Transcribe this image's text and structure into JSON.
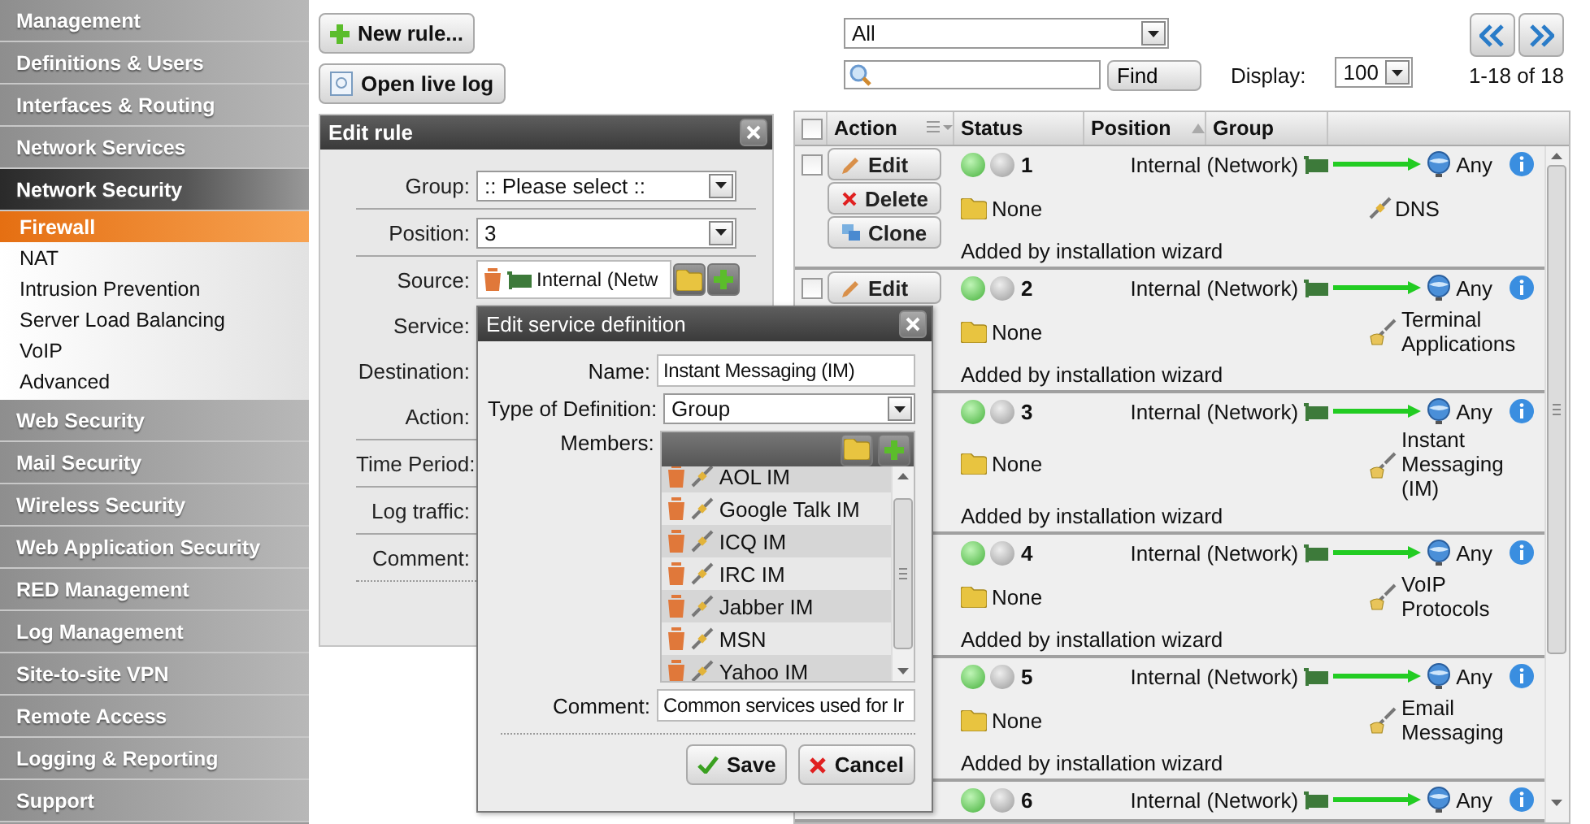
{
  "sidebar": {
    "items": [
      {
        "label": "Management",
        "expanded": false
      },
      {
        "label": "Definitions & Users",
        "expanded": false
      },
      {
        "label": "Interfaces & Routing",
        "expanded": false
      },
      {
        "label": "Network Services",
        "expanded": false
      },
      {
        "label": "Network Security",
        "expanded": true,
        "children": [
          {
            "label": "Firewall",
            "selected": true
          },
          {
            "label": "NAT",
            "selected": false
          },
          {
            "label": "Intrusion Prevention",
            "selected": false
          },
          {
            "label": "Server Load Balancing",
            "selected": false
          },
          {
            "label": "VoIP",
            "selected": false
          },
          {
            "label": "Advanced",
            "selected": false
          }
        ]
      },
      {
        "label": "Web Security",
        "expanded": false
      },
      {
        "label": "Mail Security",
        "expanded": false
      },
      {
        "label": "Wireless Security",
        "expanded": false
      },
      {
        "label": "Web Application Security",
        "expanded": false
      },
      {
        "label": "RED Management",
        "expanded": false
      },
      {
        "label": "Log Management",
        "expanded": false
      },
      {
        "label": "Site-to-site VPN",
        "expanded": false
      },
      {
        "label": "Remote Access",
        "expanded": false
      },
      {
        "label": "Logging & Reporting",
        "expanded": false
      },
      {
        "label": "Support",
        "expanded": false
      }
    ]
  },
  "toolbar": {
    "buttons": [
      {
        "label": "New rule...",
        "kind": "add"
      },
      {
        "label": "Open live log",
        "kind": "log"
      }
    ]
  },
  "filter": {
    "value": "All"
  },
  "search": {
    "button": "Find"
  },
  "display": {
    "label": "Display:",
    "value": "100"
  },
  "pager": {
    "range": "1-18 of 18"
  },
  "edit_rule": {
    "title": "Edit rule",
    "sections": [
      [
        {
          "label": "Group:",
          "kind": "select",
          "value": ":: Please select ::"
        }
      ],
      [
        {
          "label": "Position:",
          "kind": "select",
          "value": "3"
        }
      ],
      [
        {
          "label": "Source:",
          "kind": "object",
          "value": "Internal (Netw"
        },
        {
          "label": "Service:",
          "kind": "covered"
        },
        {
          "label": "Destination:",
          "kind": "covered"
        },
        {
          "label": "Action:",
          "kind": "covered"
        }
      ],
      [
        {
          "label": "Time Period:",
          "kind": "covered"
        }
      ],
      [
        {
          "label": "Log traffic:",
          "kind": "covered"
        }
      ],
      [
        {
          "label": "Comment:",
          "kind": "covered"
        }
      ]
    ]
  },
  "service_dialog": {
    "title": "Edit service definition",
    "name_label": "Name:",
    "name": "Instant Messaging (IM)",
    "type_label": "Type of Definition:",
    "type": "Group",
    "members_label": "Members:",
    "members": [
      "AOL IM",
      "Google Talk IM",
      "ICQ IM",
      "IRC IM",
      "Jabber IM",
      "MSN",
      "Yahoo IM"
    ],
    "comment_label": "Comment:",
    "comment": "Common services used for Ir",
    "buttons": [
      {
        "label": "Save",
        "kind": "save"
      },
      {
        "label": "Cancel",
        "kind": "cancel"
      }
    ]
  },
  "table": {
    "select_all": {
      "checked": false
    },
    "columns": [
      "Action",
      "Status",
      "Position",
      "Group"
    ],
    "rows": [
      {
        "checked": false,
        "actions": [
          {
            "label": "Edit",
            "kind": "edit"
          },
          {
            "label": "Delete",
            "kind": "delete"
          },
          {
            "label": "Clone",
            "kind": "clone"
          }
        ],
        "enabled": true,
        "number": "1",
        "source": "Internal (Network)",
        "destination": "Any",
        "group": "None",
        "service": {
          "kind": "single",
          "label": "DNS"
        },
        "comment": "Added by installation wizard"
      },
      {
        "checked": false,
        "actions": [
          {
            "label": "Edit",
            "kind": "edit"
          }
        ],
        "enabled": true,
        "number": "2",
        "source": "Internal (Network)",
        "destination": "Any",
        "group": "None",
        "service": {
          "kind": "group",
          "label": "Terminal Applications"
        },
        "comment": "Added by installation wizard"
      },
      {
        "enabled": true,
        "number": "3",
        "source": "Internal (Network)",
        "destination": "Any",
        "group": "None",
        "service": {
          "kind": "group",
          "label": "Instant Messaging (IM)"
        },
        "comment": "Added by installation wizard"
      },
      {
        "enabled": true,
        "number": "4",
        "source": "Internal (Network)",
        "destination": "Any",
        "group": "None",
        "service": {
          "kind": "group",
          "label": "VoIP Protocols"
        },
        "comment": "Added by installation wizard"
      },
      {
        "enabled": true,
        "number": "5",
        "source": "Internal (Network)",
        "destination": "Any",
        "group": "None",
        "service": {
          "kind": "group",
          "label": "Email Messaging"
        },
        "comment": "Added by installation wizard"
      },
      {
        "enabled": true,
        "number": "6",
        "source": "Internal (Network)",
        "destination": "Any"
      }
    ]
  }
}
